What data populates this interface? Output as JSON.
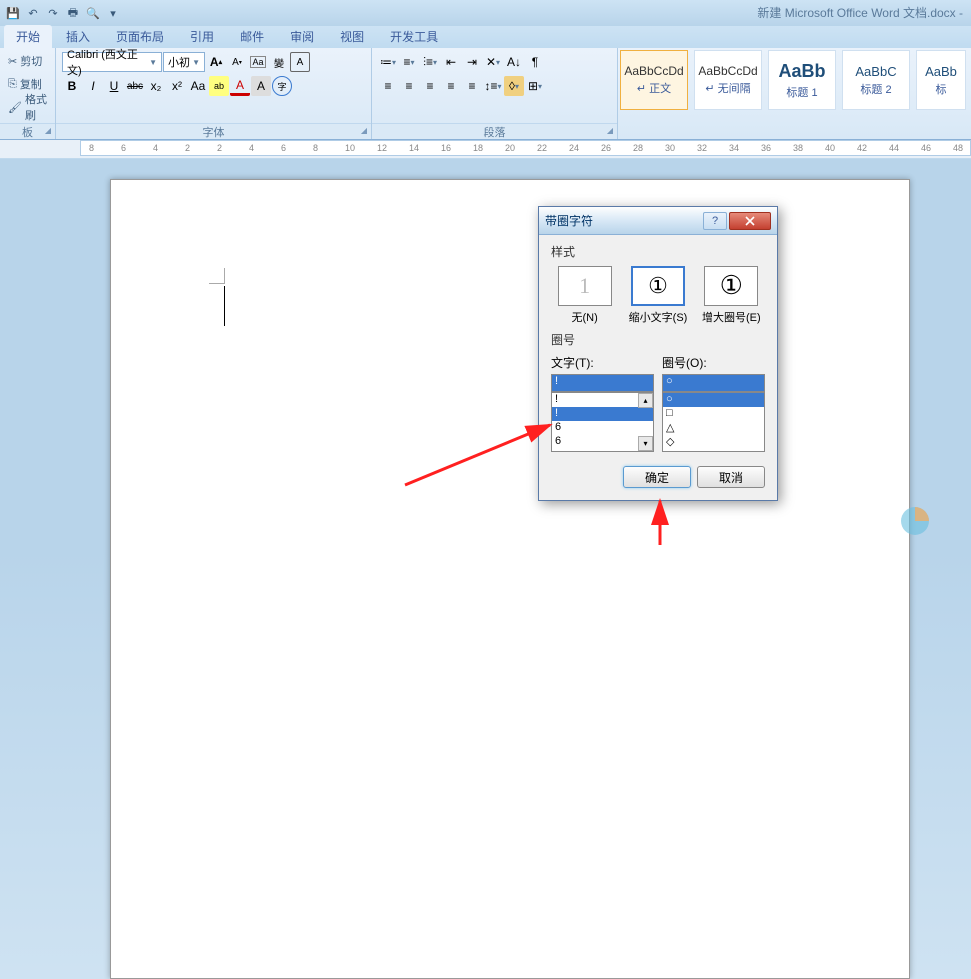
{
  "title": "新建 Microsoft Office Word 文档.docx -",
  "tabs": [
    "开始",
    "插入",
    "页面布局",
    "引用",
    "邮件",
    "审阅",
    "视图",
    "开发工具"
  ],
  "active_tab": 0,
  "clipboard": {
    "cut": "剪切",
    "copy": "复制",
    "paint": "格式刷",
    "group": "板"
  },
  "font": {
    "name": "Calibri (西文正文)",
    "size": "小初",
    "group": "字体",
    "grow": "A",
    "shrink": "A",
    "clear": "Aa",
    "phonetic": "變",
    "charborder": "A",
    "bold": "B",
    "italic": "I",
    "underline": "U",
    "strike": "abc",
    "sub": "x₂",
    "sup": "x²",
    "case": "Aa",
    "highlight": "ab",
    "color": "A",
    "charshade": "A",
    "enclosed": "字"
  },
  "paragraph": {
    "group": "段落"
  },
  "styles": [
    {
      "preview": "AaBbCcDd",
      "name": "↵ 正文",
      "cls": ""
    },
    {
      "preview": "AaBbCcDd",
      "name": "↵ 无间隔",
      "cls": ""
    },
    {
      "preview": "AaBb",
      "name": "标题 1",
      "cls": "big"
    },
    {
      "preview": "AaBbC",
      "name": "标题 2",
      "cls": "med"
    },
    {
      "preview": "AaBb",
      "name": "标",
      "cls": "med"
    }
  ],
  "ruler_marks": [
    8,
    6,
    4,
    2,
    2,
    4,
    6,
    8,
    10,
    12,
    14,
    16,
    18,
    20,
    22,
    24,
    26,
    28,
    30,
    32,
    34,
    36,
    38,
    40,
    42,
    44,
    46,
    48
  ],
  "dialog": {
    "title": "带圈字符",
    "style_label": "样式",
    "options": [
      {
        "glyph": "1",
        "label": "无(N)"
      },
      {
        "glyph": "①",
        "label": "缩小文字(S)"
      },
      {
        "glyph": "①",
        "label": "增大圈号(E)"
      }
    ],
    "selected_option": 1,
    "enclosure_label": "圈号",
    "text_label": "文字(T):",
    "text_value": "!",
    "text_list": [
      "!",
      "!",
      "6",
      "6"
    ],
    "circle_label": "圈号(O):",
    "circle_value": "○",
    "circle_list": [
      "○",
      "□",
      "△",
      "◇"
    ],
    "ok": "确定",
    "cancel": "取消"
  }
}
